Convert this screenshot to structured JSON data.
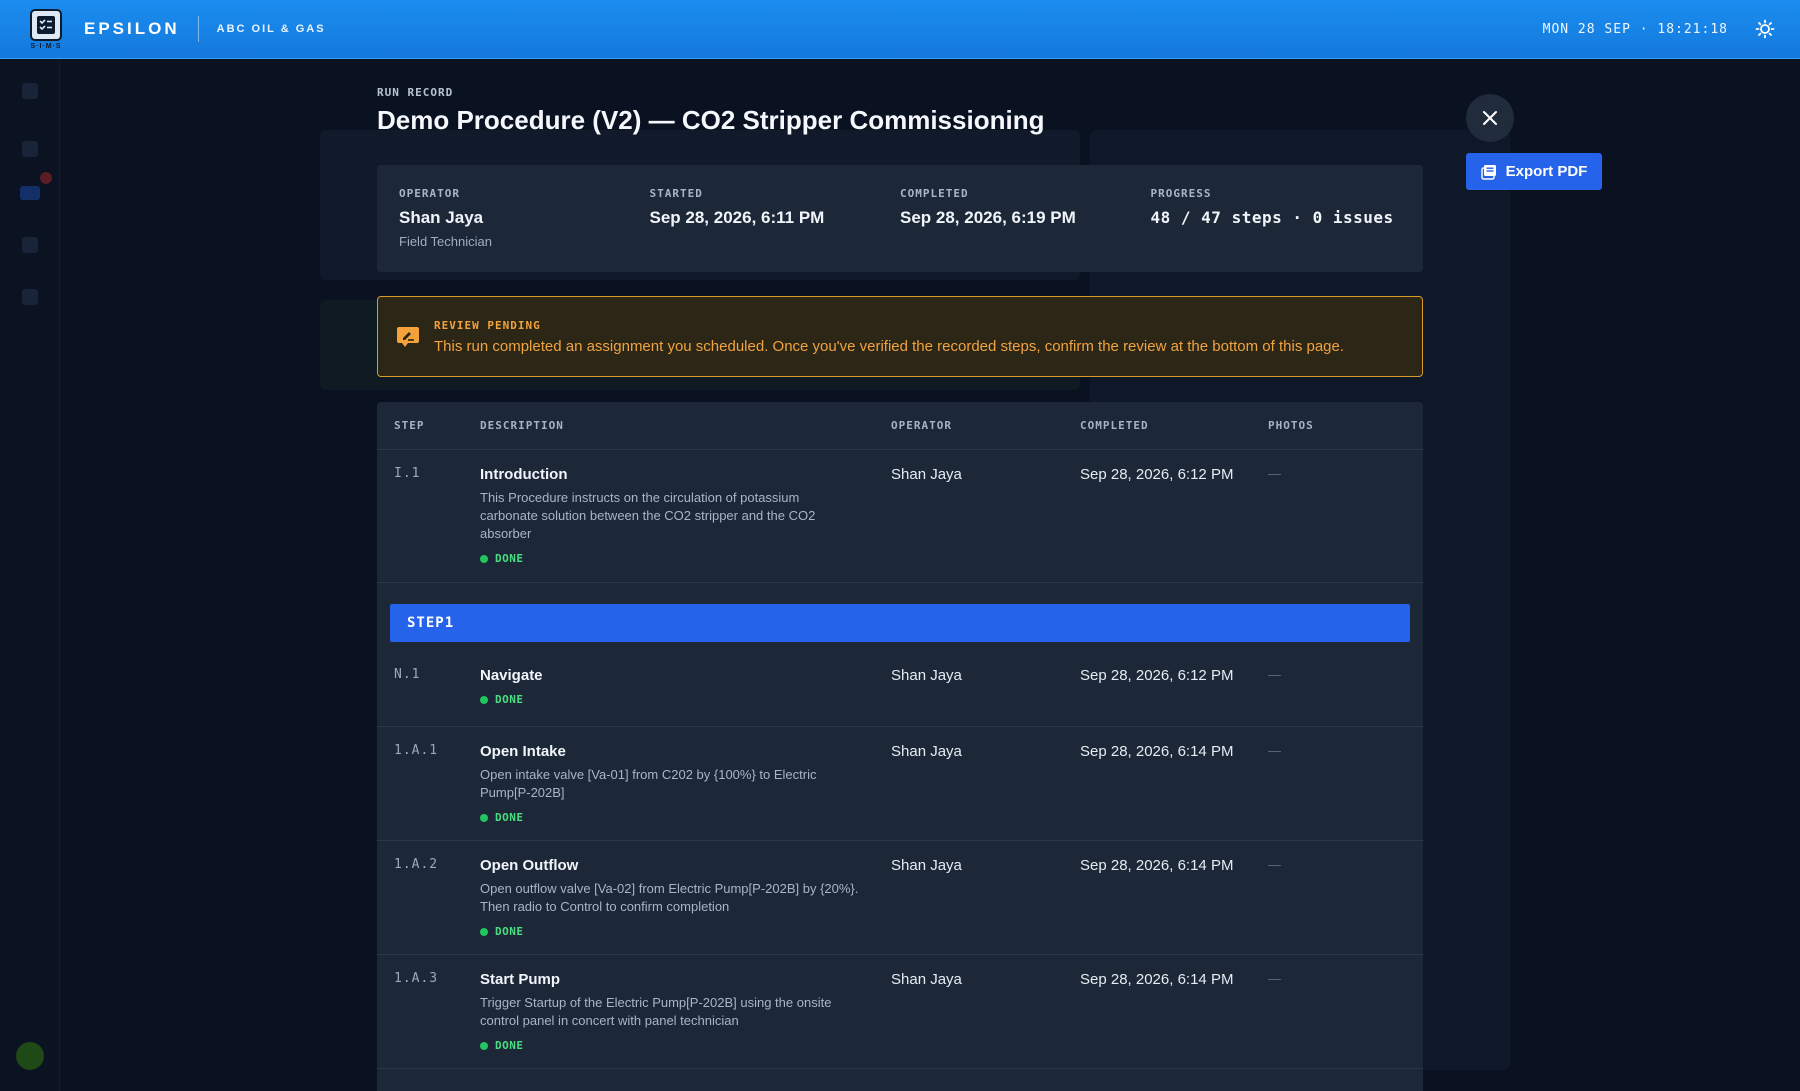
{
  "topbar": {
    "logo_sub": "S·I·M·S",
    "brand": "EPSILON",
    "org": "ABC OIL & GAS",
    "clock": "MON 28 SEP · 18:21:18",
    "accent": "#1b8df0"
  },
  "modal": {
    "eyebrow": "RUN RECORD",
    "title": "Demo Procedure (V2) — CO2 Stripper Commissioning",
    "summary": {
      "operator_label": "OPERATOR",
      "operator_name": "Shan Jaya",
      "operator_role": "Field Technician",
      "started_label": "STARTED",
      "started_value": "Sep 28, 2026, 6:11 PM",
      "completed_label": "COMPLETED",
      "completed_value": "Sep 28, 2026, 6:19 PM",
      "progress_label": "PROGRESS",
      "progress_value": "48 / 47 steps · 0 issues"
    },
    "alert": {
      "title": "REVIEW PENDING",
      "text": "This run completed an assignment you scheduled. Once you've verified the recorded steps, confirm the review at the bottom of this page.",
      "color": "#d89a2b"
    },
    "table": {
      "headers": {
        "step": "STEP",
        "description": "DESCRIPTION",
        "operator": "OPERATOR",
        "completed": "COMPLETED",
        "photos": "PHOTOS"
      },
      "rows": [
        {
          "step": "I.1",
          "title": "Introduction",
          "text": "This Procedure instructs on the circulation of potassium carbonate solution between the CO2 stripper and the CO2 absorber",
          "status": "DONE",
          "operator": "Shan Jaya",
          "completed": "Sep 28, 2026, 6:12 PM",
          "photos": "—"
        },
        {
          "step": "N.1",
          "title": "Navigate",
          "text": "",
          "status": "DONE",
          "operator": "Shan Jaya",
          "completed": "Sep 28, 2026, 6:12 PM",
          "photos": "—"
        },
        {
          "step": "1.A.1",
          "title": "Open Intake",
          "text": "Open intake valve [Va-01] from C202 by {100%} to Electric Pump[P-202B]",
          "status": "DONE",
          "operator": "Shan Jaya",
          "completed": "Sep 28, 2026, 6:14 PM",
          "photos": "—"
        },
        {
          "step": "1.A.2",
          "title": "Open Outflow",
          "text": "Open outflow valve [Va-02] from Electric Pump[P-202B] by {20%}. Then radio to Control to confirm completion",
          "status": "DONE",
          "operator": "Shan Jaya",
          "completed": "Sep 28, 2026, 6:14 PM",
          "photos": "—"
        },
        {
          "step": "1.A.3",
          "title": "Start Pump",
          "text": "Trigger Startup of the Electric Pump[P-202B] using the onsite control panel in concert with panel technician",
          "status": "DONE",
          "operator": "Shan Jaya",
          "completed": "Sep 28, 2026, 6:14 PM",
          "photos": "—"
        }
      ],
      "section": "STEP1"
    }
  },
  "actions": {
    "export_label": "Export PDF"
  },
  "icons": {
    "close": "close-icon",
    "export": "pdf-icon",
    "theme": "sun-icon",
    "alert": "edit-review-icon"
  }
}
